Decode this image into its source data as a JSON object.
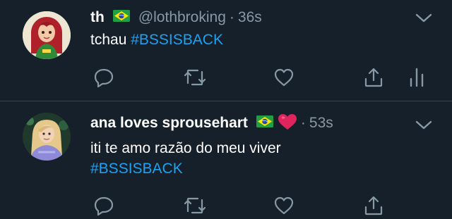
{
  "tweets": [
    {
      "name": "th",
      "flag_icon": "brazil-flag-icon",
      "handle": "@lothbroking",
      "separator": "·",
      "time": "36s",
      "text": "tchau",
      "hashtag": "#BSSISBACK",
      "actions": [
        "reply-icon",
        "retweet-icon",
        "like-icon",
        "share-icon",
        "analytics-icon"
      ]
    },
    {
      "name": "ana loves sprousehart",
      "flag_icon": "brazil-flag-icon",
      "emoji": "red-heart-icon",
      "separator": "·",
      "time": "53s",
      "text": "iti te amo razão do meu viver",
      "hashtag": "#BSSISBACK",
      "actions": [
        "reply-icon",
        "retweet-icon",
        "like-icon",
        "share-icon"
      ]
    }
  ],
  "colors": {
    "background": "#15202b",
    "text": "#ffffff",
    "muted": "#8899a6",
    "link": "#1da1f2",
    "divider": "#38444d",
    "heart": "#e0245e"
  }
}
